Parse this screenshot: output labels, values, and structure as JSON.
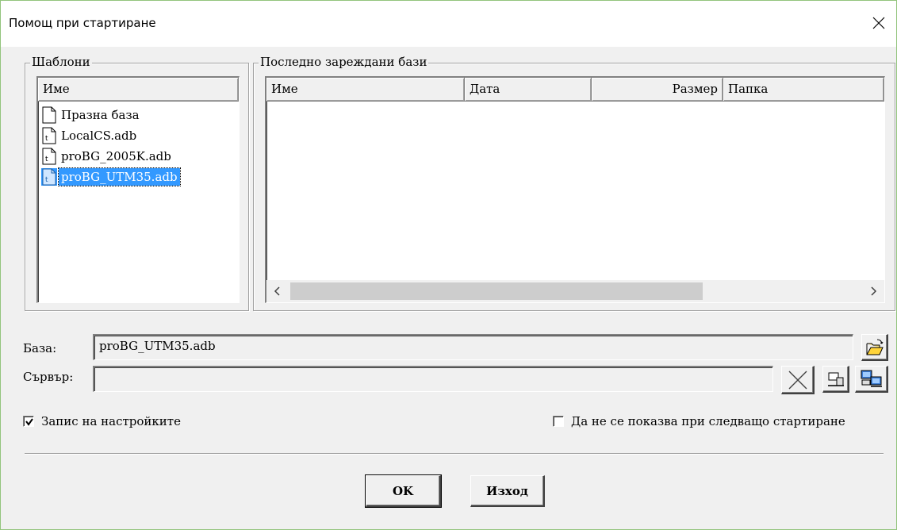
{
  "window": {
    "title": "Помощ при стартиране"
  },
  "templates": {
    "legend": "Шаблони",
    "column": "Име",
    "items": [
      {
        "label": "Празна база",
        "icon": "blank-file-icon",
        "selected": false
      },
      {
        "label": "LocalCS.adb",
        "icon": "template-file-icon",
        "selected": false
      },
      {
        "label": "proBG_2005K.adb",
        "icon": "template-file-icon",
        "selected": false
      },
      {
        "label": "proBG_UTM35.adb",
        "icon": "template-file-icon",
        "selected": true
      }
    ]
  },
  "recent": {
    "legend": "Последно зареждани бази",
    "columns": [
      "Име",
      "Дата",
      "Размер",
      "Папка"
    ],
    "rows": []
  },
  "database": {
    "label": "База:",
    "value": "proBG_UTM35.adb"
  },
  "server": {
    "label": "Сървър:",
    "value": ""
  },
  "options": {
    "save_settings": {
      "label": "Запис на настройките",
      "checked": true
    },
    "dont_show": {
      "label": "Да не се показва при следващо стартиране",
      "checked": false
    }
  },
  "buttons": {
    "ok": "OK",
    "exit": "Изход"
  },
  "colors": {
    "selection": "#3399ff",
    "dialog_bg": "#f0f0f0"
  }
}
